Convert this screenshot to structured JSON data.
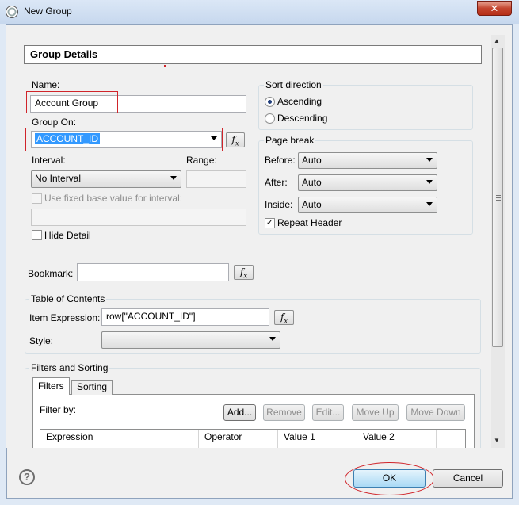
{
  "window": {
    "title": "New Group",
    "close_glyph": "✕"
  },
  "header": {
    "title": "Group Details"
  },
  "name": {
    "label": "Name:",
    "value": "Account Group"
  },
  "group_on": {
    "label": "Group On:",
    "value": "ACCOUNT_ID"
  },
  "interval": {
    "label": "Interval:",
    "value": "No Interval"
  },
  "range": {
    "label": "Range:",
    "value": ""
  },
  "fixed_base": {
    "label": "Use fixed base value for interval:",
    "checked": false,
    "value": ""
  },
  "hide_detail": {
    "label": "Hide Detail",
    "checked": false
  },
  "sort_direction": {
    "label": "Sort direction",
    "options": [
      {
        "label": "Ascending",
        "selected": true
      },
      {
        "label": "Descending",
        "selected": false
      }
    ]
  },
  "page_break": {
    "label": "Page break",
    "before": {
      "label": "Before:",
      "value": "Auto"
    },
    "after": {
      "label": "After:",
      "value": "Auto"
    },
    "inside": {
      "label": "Inside:",
      "value": "Auto"
    },
    "repeat_header": {
      "label": "Repeat Header",
      "checked": true,
      "mark": "✓"
    }
  },
  "bookmark": {
    "label": "Bookmark:",
    "value": ""
  },
  "toc": {
    "label": "Table of Contents",
    "item_expression": {
      "label": "Item Expression:",
      "value": "row[\"ACCOUNT_ID\"]"
    },
    "style": {
      "label": "Style:",
      "value": ""
    }
  },
  "filters_sorting": {
    "label": "Filters and Sorting",
    "tabs": [
      "Filters",
      "Sorting"
    ],
    "filter_by_label": "Filter by:",
    "buttons": {
      "add": "Add...",
      "remove": "Remove",
      "edit": "Edit...",
      "move_up": "Move Up",
      "move_down": "Move Down"
    },
    "columns": [
      "Expression",
      "Operator",
      "Value 1",
      "Value 2"
    ]
  },
  "fx_label": "f",
  "fx_sub": "x",
  "help": "?",
  "footer": {
    "ok": "OK",
    "cancel": "Cancel"
  },
  "colors": {
    "annotation": "#d0242a",
    "selection": "#3399ff"
  }
}
